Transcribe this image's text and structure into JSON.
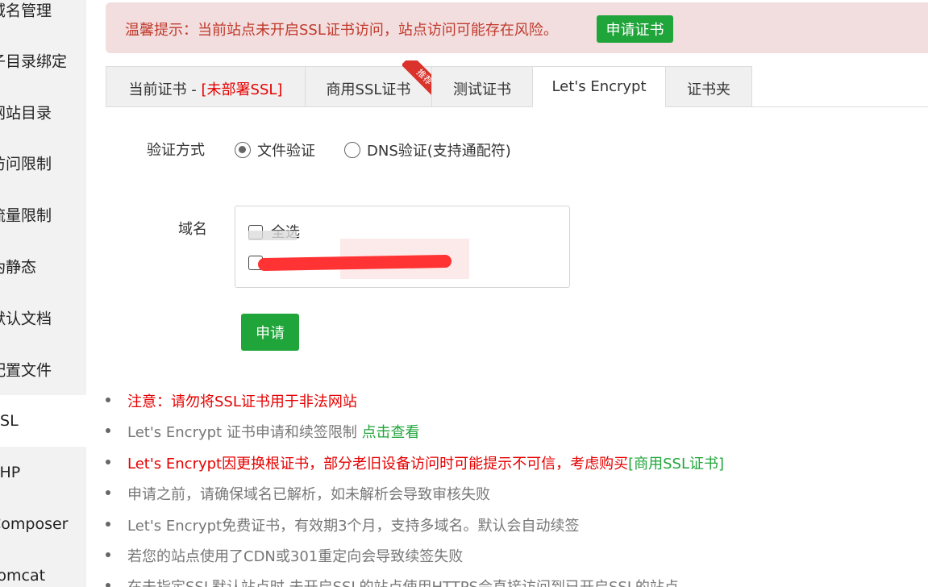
{
  "sidebar": {
    "items": [
      {
        "label": "域名管理"
      },
      {
        "label": "子目录绑定"
      },
      {
        "label": "网站目录"
      },
      {
        "label": "访问限制"
      },
      {
        "label": "流量限制"
      },
      {
        "label": "伪静态"
      },
      {
        "label": "默认文档"
      },
      {
        "label": "配置文件"
      },
      {
        "label": "SSL"
      },
      {
        "label": "PHP"
      },
      {
        "label": "Composer"
      },
      {
        "label": "Tomcat"
      }
    ]
  },
  "alert": {
    "text": "温馨提示：当前站点未开启SSL证书访问，站点访问可能存在风险。",
    "button_label": "申请证书"
  },
  "tabs": [
    {
      "label": "当前证书 - ",
      "status": "[未部署SSL]"
    },
    {
      "label": "商用SSL证书",
      "badge": "推荐"
    },
    {
      "label": "测试证书"
    },
    {
      "label": "Let's Encrypt"
    },
    {
      "label": "证书夹"
    }
  ],
  "form": {
    "verify_label": "验证方式",
    "verify_options": [
      {
        "label": "文件验证",
        "checked": true
      },
      {
        "label": "DNS验证(支持通配符)",
        "checked": false
      }
    ],
    "domain_label": "域名",
    "select_all_label": "全选",
    "apply_label": "申请"
  },
  "notes": [
    {
      "text": "注意：请勿将SSL证书用于非法网站",
      "warn": true
    },
    {
      "text": "Let's Encrypt 证书申请和续签限制 ",
      "link": "点击查看",
      "warn": false
    },
    {
      "text": "Let's Encrypt因更换根证书，部分老旧设备访问时可能提示不可信，考虑购买",
      "link": "[商用SSL证书]",
      "warn": true
    },
    {
      "text": "申请之前，请确保域名已解析，如未解析会导致审核失败",
      "warn": false
    },
    {
      "text": "Let's Encrypt免费证书，有效期3个月，支持多域名。默认会自动续签",
      "warn": false
    },
    {
      "text": "若您的站点使用了CDN或301重定向会导致续签失败",
      "warn": false
    },
    {
      "text": "在未指定SSL默认站点时,未开启SSL的站点使用HTTPS会直接访问到已开启SSL的站点",
      "warn": false
    }
  ],
  "colors": {
    "accent": "#20a53a",
    "warning": "#e60000",
    "alert_bg": "#f2dedf"
  }
}
